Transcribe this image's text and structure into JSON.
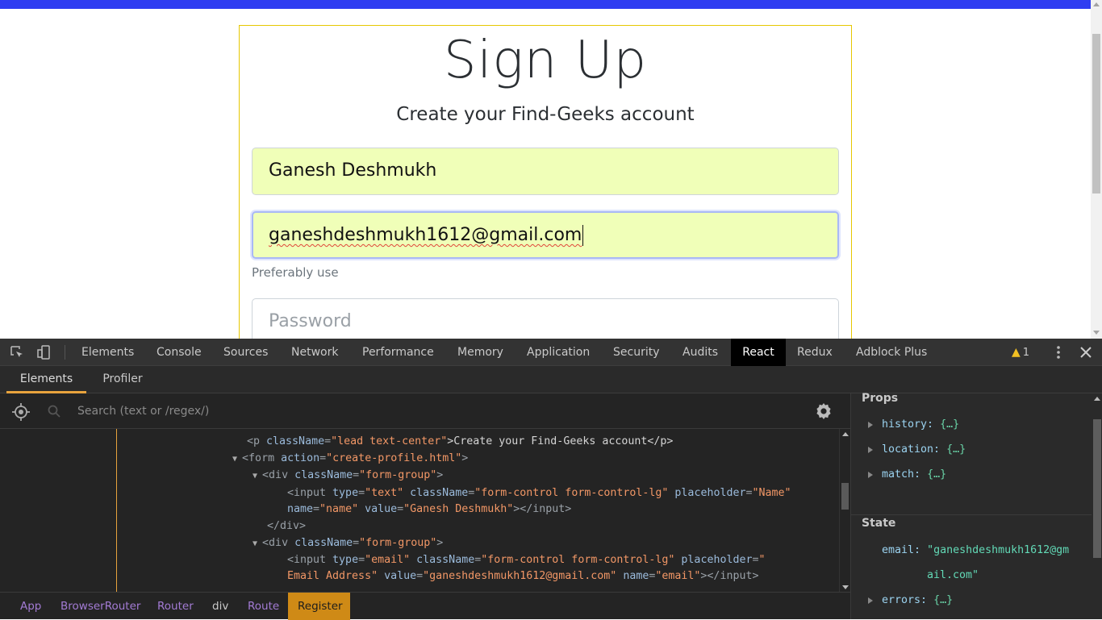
{
  "page": {
    "title": "Sign Up",
    "subtitle": "Create your Find-Geeks account",
    "name_value": "Ganesh Deshmukh",
    "email_value": "ganeshdeshmukh1612@gmail.com",
    "hint": "Preferably use",
    "password_placeholder": "Password",
    "colors": {
      "topbar": "#2f3df1",
      "card_border": "#e6c800",
      "autofill": "#f0ffb8"
    }
  },
  "devtools": {
    "tabs": [
      "Elements",
      "Console",
      "Sources",
      "Network",
      "Performance",
      "Memory",
      "Application",
      "Security",
      "Audits",
      "React",
      "Redux",
      "Adblock Plus"
    ],
    "active_tab": "React",
    "warning_count": "1",
    "sub_tabs": [
      "Elements",
      "Profiler"
    ],
    "active_sub_tab": "Elements",
    "search_placeholder": "Search (text or /regex/)",
    "tree": {
      "p_tag_open": "<p ",
      "p_attr": "className",
      "p_val": "\"lead text-center\"",
      "p_text": ">Create your Find-Geeks account</p>",
      "form_open": "<form ",
      "form_attr": "action",
      "form_val": "\"create-profile.html\"",
      "form_close": ">",
      "div_open": "<div ",
      "div_attr": "className",
      "div_val": "\"form-group\"",
      "div_close": ">",
      "input1_open": "<input ",
      "type_attr": "type",
      "type_text": "\"text\"",
      "class_attr": "className",
      "class_val": "\"form-control form-control-lg\"",
      "placeholder_attr": "placeholder",
      "placeholder_name": "\"Name\"",
      "name_attr": "name",
      "name_val": "\"name\"",
      "value_attr": "value",
      "value_name": "\"Ganesh Deshmukh\"",
      "input_close": "></input>",
      "div_end": "</div>",
      "input2_open": "<input ",
      "type_email": "\"email\"",
      "placeholder_open": "\"",
      "email_placeholder_text": "Email Address\"",
      "value_email": "\"ganeshdeshmukh1612@gmail.com\"",
      "name_email": "\"email\""
    },
    "breadcrumbs": [
      "App",
      "BrowserRouter",
      "Router",
      "div",
      "Route",
      "Register"
    ],
    "side": {
      "props_title": "Props",
      "props": [
        {
          "key": "history:",
          "value": "{…}"
        },
        {
          "key": "location:",
          "value": "{…}"
        },
        {
          "key": "match:",
          "value": "{…}"
        }
      ],
      "state_title": "State",
      "state_email_key": "email:",
      "state_email_line1": "\"ganeshdeshmukh1612@gm",
      "state_email_line2": "ail.com\"",
      "state_errors_key": "errors:",
      "state_errors_value": "{…}"
    }
  }
}
